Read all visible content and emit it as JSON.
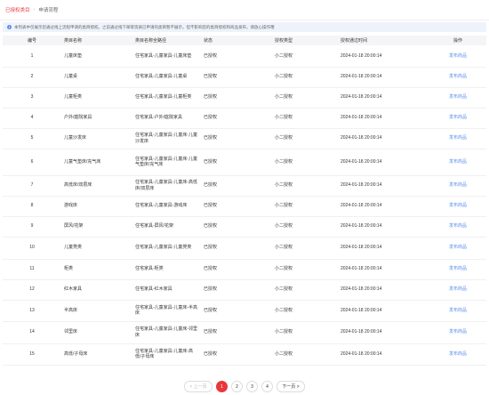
{
  "tabs": [
    {
      "label": "已授权类目"
    },
    {
      "label": "申请流程"
    }
  ],
  "notice": {
    "text": "本列表中仅展示您通过线上流程申请的类目授权。之前通过线下邮寄资质已申请的类目暂不展示，但不影响您的类目授权和商品发布，请放心操作哦"
  },
  "table": {
    "headers": {
      "index": "编号",
      "name": "类目名称",
      "path": "类目名称全路径",
      "status": "状态",
      "auth_type": "授权类型",
      "auth_time": "授权通过时间",
      "action": "操作"
    },
    "rows": [
      {
        "index": "1",
        "name": "儿童床垫",
        "path": "住宅家具-儿童家具-儿童床垫",
        "status": "已授权",
        "auth_type": "小二授权",
        "auth_time": "2024-01-18 20:00:14",
        "action": "发布商品"
      },
      {
        "index": "2",
        "name": "儿童桌",
        "path": "住宅家具-儿童家具-儿童桌",
        "status": "已授权",
        "auth_type": "小二授权",
        "auth_time": "2024-01-18 20:00:14",
        "action": "发布商品"
      },
      {
        "index": "3",
        "name": "儿童柜类",
        "path": "住宅家具-儿童家具-儿童柜类",
        "status": "已授权",
        "auth_type": "小二授权",
        "auth_time": "2024-01-18 20:00:14",
        "action": "发布商品"
      },
      {
        "index": "4",
        "name": "户外/庭院家具",
        "path": "住宅家具-户外/庭院家具",
        "status": "已授权",
        "auth_type": "小二授权",
        "auth_time": "2024-01-18 20:00:14",
        "action": "发布商品"
      },
      {
        "index": "5",
        "name": "儿童沙发床",
        "path": "住宅家具-儿童家具-儿童床-儿童沙发床",
        "status": "已授权",
        "auth_type": "小二授权",
        "auth_time": "2024-01-18 20:00:14",
        "action": "发布商品"
      },
      {
        "index": "6",
        "name": "儿童气垫床/充气床",
        "path": "住宅家具-儿童家具-儿童床-儿童气垫床/充气床",
        "status": "已授权",
        "auth_type": "小二授权",
        "auth_time": "2024-01-18 20:00:14",
        "action": "发布商品"
      },
      {
        "index": "7",
        "name": "高低床/双层床",
        "path": "住宅家具-儿童家具-儿童床-高低床/双层床",
        "status": "已授权",
        "auth_type": "小二授权",
        "auth_time": "2024-01-18 20:00:14",
        "action": "发布商品"
      },
      {
        "index": "8",
        "name": "游戏床",
        "path": "住宅家具-儿童家具-游戏床",
        "status": "已授权",
        "auth_type": "小二授权",
        "auth_time": "2024-01-18 20:00:14",
        "action": "发布商品"
      },
      {
        "index": "9",
        "name": "屏风/花架",
        "path": "住宅家具-屏风/花架",
        "status": "已授权",
        "auth_type": "小二授权",
        "auth_time": "2024-01-18 20:00:14",
        "action": "发布商品"
      },
      {
        "index": "10",
        "name": "儿童凳类",
        "path": "住宅家具-儿童家具-儿童凳类",
        "status": "已授权",
        "auth_type": "小二授权",
        "auth_time": "2024-01-18 20:00:14",
        "action": "发布商品"
      },
      {
        "index": "11",
        "name": "柜类",
        "path": "住宅家具-柜类",
        "status": "已授权",
        "auth_type": "小二授权",
        "auth_time": "2024-01-18 20:00:14",
        "action": "发布商品"
      },
      {
        "index": "12",
        "name": "红木家具",
        "path": "住宅家具-红木家具",
        "status": "已授权",
        "auth_type": "小二授权",
        "auth_time": "2024-01-18 20:00:14",
        "action": "发布商品"
      },
      {
        "index": "13",
        "name": "半高床",
        "path": "住宅家具-儿童家具-儿童床-半高床",
        "status": "已授权",
        "auth_type": "小二授权",
        "auth_time": "2024-01-18 20:00:14",
        "action": "发布商品"
      },
      {
        "index": "14",
        "name": "邻里床",
        "path": "住宅家具-儿童家具-儿童床-邻里床",
        "status": "已授权",
        "auth_type": "小二授权",
        "auth_time": "2024-01-18 20:00:14",
        "action": "发布商品"
      },
      {
        "index": "15",
        "name": "高低/子母床",
        "path": "住宅家具-儿童家具-儿童床-高低/子母床",
        "status": "已授权",
        "auth_type": "小二授权",
        "auth_time": "2024-01-18 20:00:14",
        "action": "发布商品"
      }
    ]
  },
  "pagination": {
    "prev": "< 上一页",
    "pages": [
      "1",
      "2",
      "3",
      "4"
    ],
    "current": "1",
    "next": "下一页 >"
  },
  "colors": {
    "accent": "#e8383d",
    "link": "#5b8def"
  }
}
